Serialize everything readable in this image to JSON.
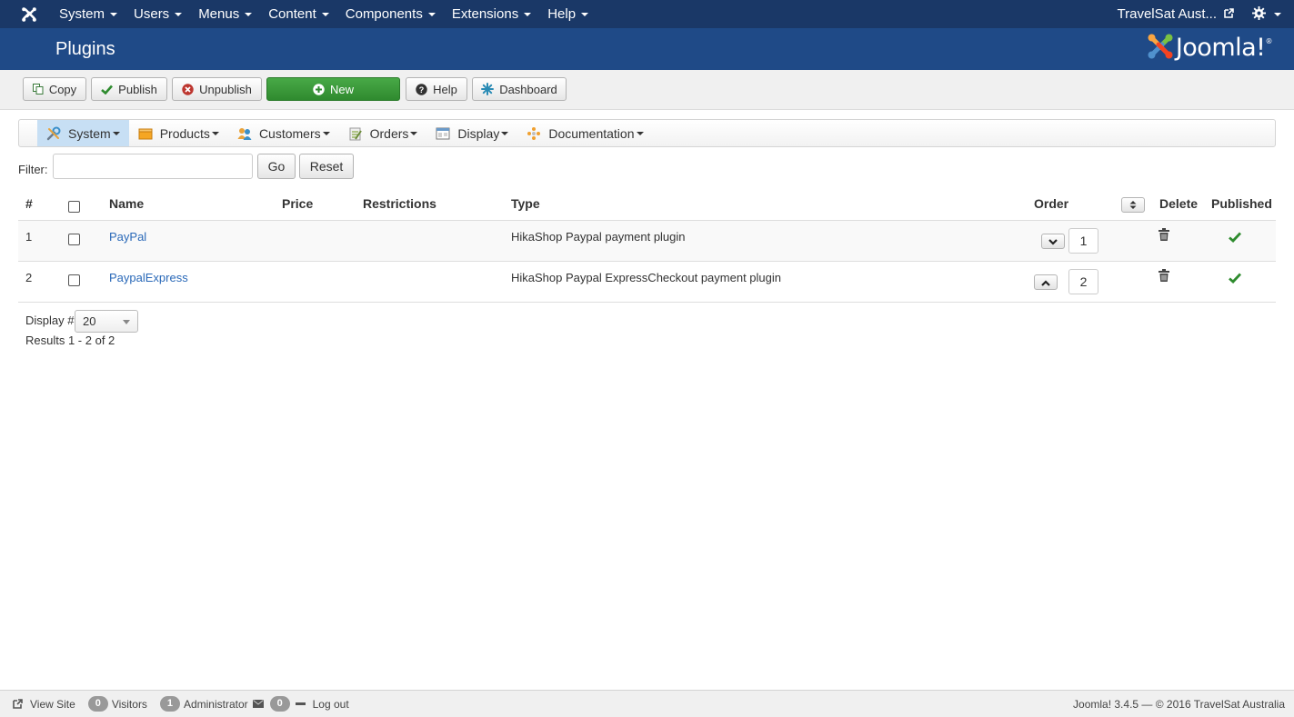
{
  "nav": {
    "items": [
      {
        "label": "System"
      },
      {
        "label": "Users"
      },
      {
        "label": "Menus"
      },
      {
        "label": "Content"
      },
      {
        "label": "Components"
      },
      {
        "label": "Extensions"
      },
      {
        "label": "Help"
      }
    ],
    "site_name": "TravelSat Aust...",
    "logo_icon": "joomla-logo-icon",
    "settings_icon": "gear-icon"
  },
  "header": {
    "title": "Plugins",
    "brand_text": "Joomla!",
    "brand_mark": "®"
  },
  "toolbar": {
    "copy": "Copy",
    "publish": "Publish",
    "unpublish": "Unpublish",
    "new": "New",
    "help": "Help",
    "dashboard": "Dashboard"
  },
  "submenu": [
    {
      "label": "System",
      "icon": "wrench-icon"
    },
    {
      "label": "Products",
      "icon": "box-icon"
    },
    {
      "label": "Customers",
      "icon": "people-icon"
    },
    {
      "label": "Orders",
      "icon": "orders-icon"
    },
    {
      "label": "Display",
      "icon": "display-icon"
    },
    {
      "label": "Documentation",
      "icon": "documentation-icon"
    }
  ],
  "filter": {
    "label": "Filter:",
    "value": "",
    "go": "Go",
    "reset": "Reset"
  },
  "table": {
    "headers": {
      "num": "#",
      "name": "Name",
      "price": "Price",
      "restrictions": "Restrictions",
      "type": "Type",
      "order": "Order",
      "delete": "Delete",
      "published": "Published"
    },
    "rows": [
      {
        "num": "1",
        "name": "PayPal",
        "price": "",
        "restrictions": "",
        "type": "HikaShop Paypal payment plugin",
        "order": "1",
        "published": true
      },
      {
        "num": "2",
        "name": "PaypalExpress",
        "price": "",
        "restrictions": "",
        "type": "HikaShop Paypal ExpressCheckout payment plugin",
        "order": "2",
        "published": true
      }
    ]
  },
  "pagination": {
    "display_label": "Display #",
    "display_value": "20",
    "results": "Results 1 - 2 of 2"
  },
  "status": {
    "view_site": "View Site",
    "visitors_count": "0",
    "visitors_label": "Visitors",
    "admin_count": "1",
    "admin_label": "Administrator",
    "messages_count": "0",
    "logout": "Log out",
    "footer": "Joomla! 3.4.5 — © 2016 TravelSat Australia"
  },
  "colors": {
    "navbar": "#1a3867",
    "header": "#1f4a87",
    "new_button": "#3a9a3a",
    "link": "#2a69b8",
    "published_check": "#2e8b2e"
  }
}
